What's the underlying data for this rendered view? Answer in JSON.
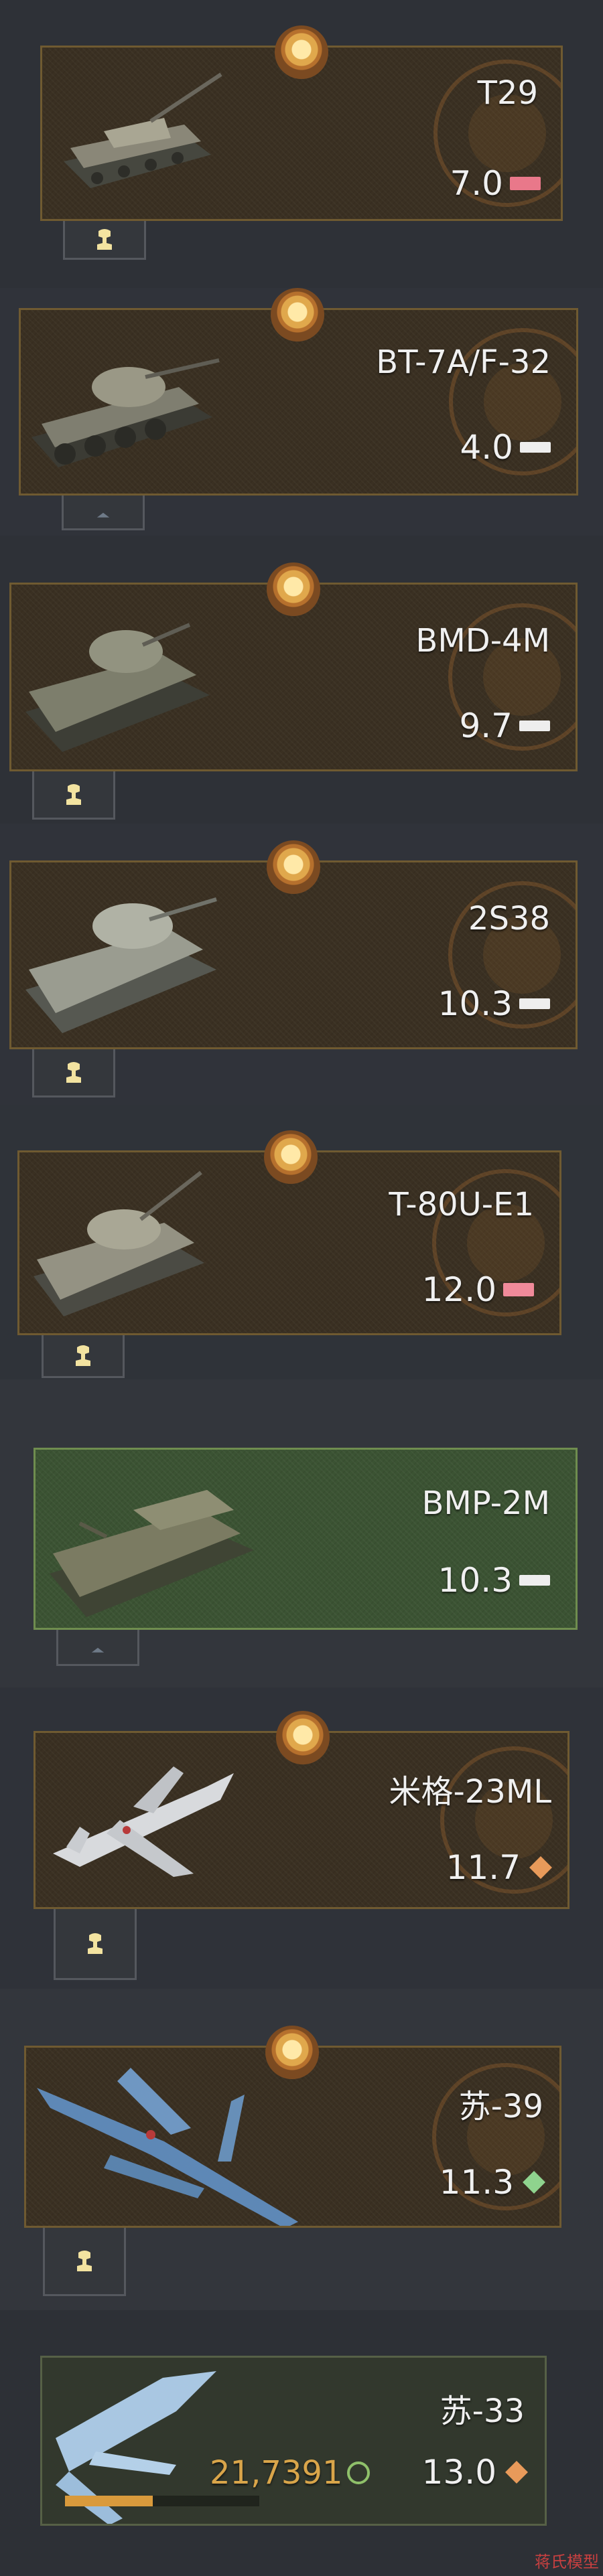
{
  "vehicles": [
    {
      "name": "T29",
      "br": "7.0",
      "rank_color": "#e9788a"
    },
    {
      "name": "BT-7A/F-32",
      "br": "4.0",
      "rank_color": "#eeeeee"
    },
    {
      "name": "BMD-4M",
      "br": "9.7",
      "rank_color": "#eeeeee"
    },
    {
      "name": "2S38",
      "br": "10.3",
      "rank_color": "#eeeeee"
    },
    {
      "name": "T-80U-E1",
      "br": "12.0",
      "rank_color": "#f08a9a"
    },
    {
      "name": "BMP-2M",
      "br": "10.3",
      "rank_color": "#eeeeee",
      "state": "selected"
    },
    {
      "name": "米格-23ML",
      "br": "11.7",
      "rank_color": "#e89a5a"
    },
    {
      "name": "苏-39",
      "br": "11.3",
      "rank_color": "#8fd38e"
    },
    {
      "name": "苏-33",
      "br": "13.0",
      "rank_color": "#e89a5a",
      "research_points": "21,7391",
      "research_progress": 0.45
    }
  ],
  "icons": {
    "medal": "medal-icon",
    "crew": "crew-icon",
    "tank": "tank-icon",
    "jet": "jet-icon",
    "research": "research-icon"
  },
  "watermark": "蒋氏模型"
}
